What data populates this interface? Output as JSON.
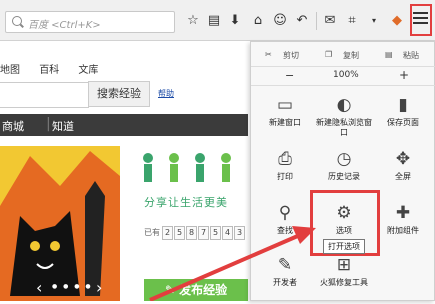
{
  "toolbar": {
    "url_placeholder": "百度 <Ctrl+K>",
    "icons": [
      "star-icon",
      "clipboard-icon",
      "download-icon",
      "home-icon",
      "smiley-icon",
      "back-icon",
      "chat-icon",
      "crop-icon",
      "addon-icon",
      "menu-icon"
    ]
  },
  "page": {
    "links": [
      "地图",
      "百科",
      "文库"
    ],
    "search_button": "搜索经验",
    "help": "帮助",
    "nav": [
      "商城",
      "知道"
    ],
    "slogan": "分享让生活更美",
    "counter_prefix": "已有",
    "counter_digits": [
      "2",
      "5",
      "8",
      "7",
      "5",
      "4",
      "3"
    ],
    "publish": "发布经验"
  },
  "menu": {
    "edit": {
      "cut": "剪切",
      "copy": "复制",
      "paste": "粘贴"
    },
    "zoom": {
      "minus": "−",
      "level": "100%",
      "plus": "+"
    },
    "items": [
      {
        "label": "新建窗口",
        "icon": "new-window-icon"
      },
      {
        "label": "新建隐私浏览窗口",
        "icon": "private-mask-icon"
      },
      {
        "label": "保存页面",
        "icon": "save-page-icon"
      },
      {
        "label": "打印",
        "icon": "print-icon"
      },
      {
        "label": "历史记录",
        "icon": "history-icon"
      },
      {
        "label": "全屏",
        "icon": "fullscreen-icon"
      },
      {
        "label": "查找",
        "icon": "find-icon"
      },
      {
        "label": "选项",
        "icon": "options-gear-icon"
      },
      {
        "label": "附加组件",
        "icon": "addons-puzzle-icon"
      },
      {
        "label": "开发者",
        "icon": "developer-wrench-icon"
      },
      {
        "label": "火狐修复工具",
        "icon": "repair-kit-icon"
      }
    ],
    "tooltip": "打开选项"
  },
  "colors": {
    "highlight": "#e23e3e",
    "nav_bg": "#3b3b3b",
    "publish_green": "#6bc04b",
    "banner_yellow": "#f2c832"
  }
}
